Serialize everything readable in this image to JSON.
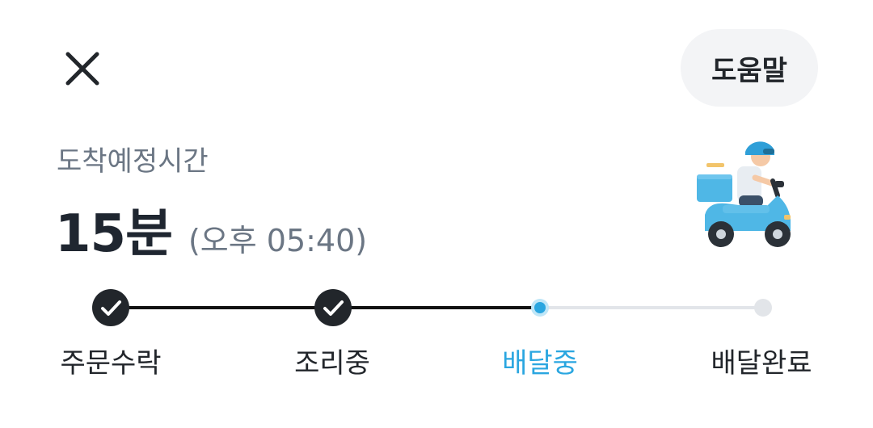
{
  "header": {
    "close_icon": "close-icon",
    "help_label": "도움말"
  },
  "eta": {
    "label": "도착예정시간",
    "minutes": "15분",
    "clock": "(오후 05:40)"
  },
  "illustration": "delivery-scooter-rider-icon",
  "progress": {
    "current_step_index": 2,
    "steps": [
      {
        "label": "주문수락",
        "status": "done"
      },
      {
        "label": "조리중",
        "status": "done"
      },
      {
        "label": "배달중",
        "status": "current"
      },
      {
        "label": "배달완료",
        "status": "pending"
      }
    ]
  },
  "colors": {
    "accent": "#2aa6e0",
    "done_fill": "#22262b",
    "pending_track": "#e2e5e9",
    "text_primary": "#22262b",
    "text_secondary": "#6b7684",
    "help_bg": "#f3f4f6"
  }
}
